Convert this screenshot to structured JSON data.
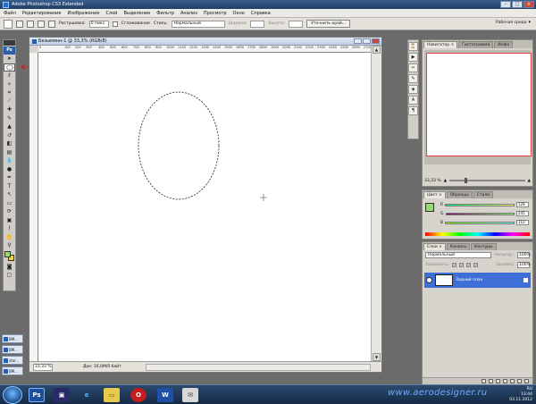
{
  "app": {
    "title": "Adobe Photoshop CS3 Extended"
  },
  "menu": [
    "Файл",
    "Редактирование",
    "Изображение",
    "Слой",
    "Выделение",
    "Фильтр",
    "Анализ",
    "Просмотр",
    "Окно",
    "Справка"
  ],
  "options": {
    "feather_label": "Растушевка:",
    "feather_value": "0 пикс.",
    "antialias_label": "Сглаживание",
    "style_label": "Стиль:",
    "style_value": "Нормальный",
    "width_label": "Ширина:",
    "height_label": "Высота:",
    "refine_button": "Уточнить край...",
    "workspace_label": "Рабочая среда"
  },
  "document": {
    "title": "Безымянн-1 @ 33,3% (RGB/8)",
    "zoom": "33,33 %",
    "doc_info": "Док: 16,0M/0 байт",
    "ruler_marks": [
      "0",
      "100",
      "200",
      "300",
      "400",
      "500",
      "600",
      "700",
      "800",
      "900",
      "1000",
      "1100",
      "1200",
      "1300",
      "1400",
      "1500",
      "1600",
      "1700",
      "1800",
      "1900",
      "2000",
      "2100",
      "2200",
      "2300",
      "2400",
      "2500",
      "2600",
      "2700"
    ]
  },
  "navigator": {
    "tabs": [
      "Навигатор ×",
      "Гистограмма",
      "Инфо"
    ],
    "zoom": "33,33 %"
  },
  "color_panel": {
    "tabs": [
      "Цвет ×",
      "Образцы",
      "Стили"
    ],
    "r_label": "R",
    "g_label": "G",
    "b_label": "B",
    "r": "128",
    "g": "245",
    "b": "110"
  },
  "layers_panel": {
    "tabs": [
      "Слои ×",
      "Каналы",
      "Контуры"
    ],
    "blend_mode": "Нормальный",
    "opacity_label": "Непрозр.:",
    "opacity": "100%",
    "lock_label": "Закрепить:",
    "fill_label": "Заливка:",
    "fill": "100%",
    "layer_name": "Задний план"
  },
  "minimized": [
    "ВМ...",
    "ВМ...",
    "ВМ...",
    "ВМ...",
    "ВМ..."
  ],
  "minimized_labels": [
    "ВМ...",
    "ВМ...",
    "stor...",
    "ВМ..."
  ],
  "taskbar": {
    "time": "13:44",
    "date": "03.11.2012",
    "lang": "RU"
  },
  "watermark": "www.aerodesigner.ru",
  "colors": {
    "foreground": "#9bd86f",
    "background": "#f0d24a",
    "selection_accent": "#3d6fd6"
  }
}
